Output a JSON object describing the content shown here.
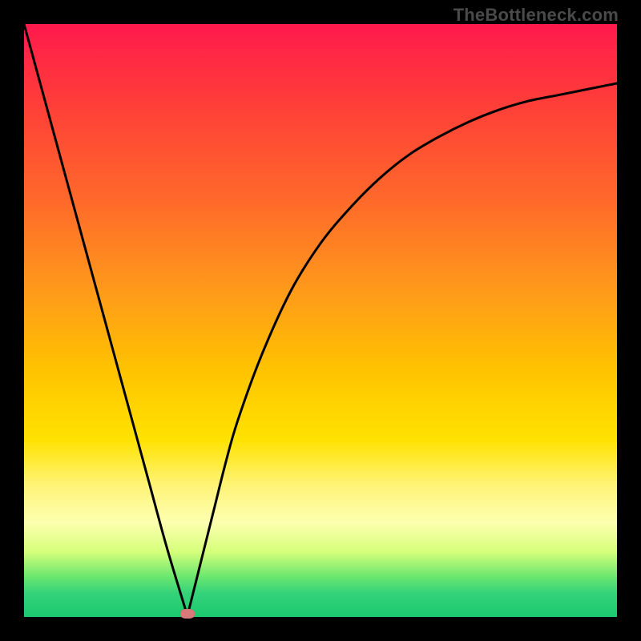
{
  "attribution": "TheBottleneck.com",
  "chart_data": {
    "type": "line",
    "title": "",
    "xlabel": "",
    "ylabel": "",
    "xlim": [
      0,
      100
    ],
    "ylim": [
      0,
      100
    ],
    "grid": false,
    "legend": false,
    "background_gradient": {
      "direction": "vertical",
      "stops": [
        {
          "pos": 0.0,
          "color": "#ff1a4d"
        },
        {
          "pos": 0.3,
          "color": "#ff6a2a"
        },
        {
          "pos": 0.58,
          "color": "#ffc200"
        },
        {
          "pos": 0.78,
          "color": "#fff47a"
        },
        {
          "pos": 0.93,
          "color": "#6fe86f"
        },
        {
          "pos": 1.0,
          "color": "#1bc96e"
        }
      ]
    },
    "series": [
      {
        "name": "bottleneck-curve",
        "type": "line",
        "stroke": "#000000",
        "x": [
          0,
          3,
          6,
          9,
          12,
          15,
          18,
          21,
          24,
          27,
          27.5,
          28,
          30,
          32,
          34,
          36,
          40,
          45,
          50,
          55,
          60,
          65,
          70,
          75,
          80,
          85,
          90,
          95,
          100
        ],
        "values": [
          100,
          89,
          78,
          67,
          56,
          45,
          34,
          23,
          12,
          2,
          0.5,
          2,
          10,
          18,
          26,
          33,
          44,
          55,
          63,
          69,
          74,
          78,
          81,
          83.5,
          85.5,
          87,
          88,
          89,
          90
        ]
      }
    ],
    "markers": [
      {
        "name": "optimum-point",
        "x": 27.5,
        "y": 0.5,
        "color": "#d87a7a",
        "shape": "ellipse"
      }
    ]
  }
}
